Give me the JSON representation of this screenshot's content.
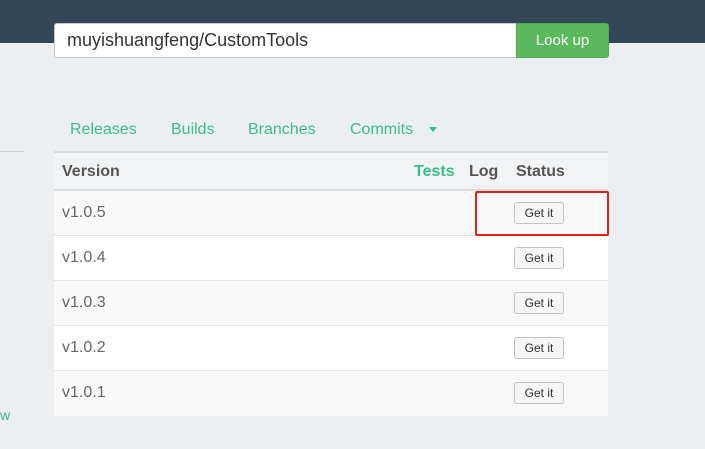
{
  "search": {
    "value": "muyishuangfeng/CustomTools",
    "button_label": "Look up"
  },
  "side": {
    "link_fragment": "w"
  },
  "tabs": [
    {
      "label": "Releases"
    },
    {
      "label": "Builds"
    },
    {
      "label": "Branches"
    },
    {
      "label": "Commits"
    }
  ],
  "table": {
    "headers": {
      "version": "Version",
      "tests": "Tests",
      "log": "Log",
      "status": "Status"
    },
    "rows": [
      {
        "version": "v1.0.5",
        "action": "Get it"
      },
      {
        "version": "v1.0.4",
        "action": "Get it"
      },
      {
        "version": "v1.0.3",
        "action": "Get it"
      },
      {
        "version": "v1.0.2",
        "action": "Get it"
      },
      {
        "version": "v1.0.1",
        "action": "Get it"
      }
    ]
  },
  "colors": {
    "topbar": "#344759",
    "accent": "#3cbd8c",
    "button": "#5cb85c",
    "highlight": "#e0201f"
  }
}
